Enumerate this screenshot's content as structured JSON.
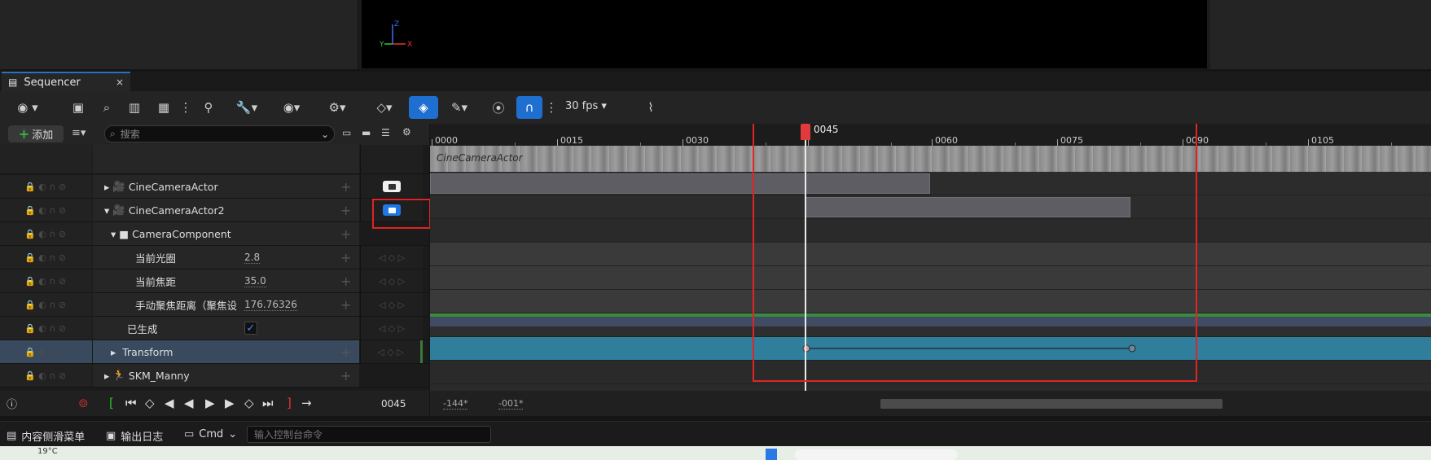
{
  "window": {
    "tab_title": "Sequencer",
    "close_glyph": "×"
  },
  "viewport": {
    "axis_z": "Z",
    "axis_y": "Y",
    "axis_x": "X"
  },
  "toolbar": {
    "fps_label": "30 fps",
    "icons": [
      "world-icon",
      "save-icon",
      "find-icon",
      "render-movie-icon",
      "clapper-icon",
      "more-icon",
      "actor-icon",
      "wrench-icon",
      "eye-icon",
      "gear-icon",
      "key-icon",
      "auto-key-icon",
      "pen-icon",
      "pin-icon",
      "snap-icon",
      "curve-editor-icon"
    ],
    "accent": "#1f6fd1"
  },
  "filterbar": {
    "add_label": "添加",
    "search_placeholder": "搜索"
  },
  "tree": {
    "rows": [
      {
        "label": "CineCameraActor",
        "indent": 1,
        "expanded": false
      },
      {
        "label": "CineCameraActor2",
        "indent": 1,
        "expanded": true
      },
      {
        "label": "CameraComponent",
        "indent": 2,
        "expanded": true
      },
      {
        "label": "当前光圈",
        "value": "2.8"
      },
      {
        "label": "当前焦距",
        "value": "35.0"
      },
      {
        "label": "手动聚焦距离（聚焦设",
        "value": "176.76326"
      },
      {
        "label": "已生成",
        "checked": true
      },
      {
        "label": "Transform",
        "selected": true
      },
      {
        "label": "SKM_Manny",
        "indent": 1
      }
    ]
  },
  "timeline": {
    "ruler_labels": [
      "0000",
      "0015",
      "0030",
      "0045",
      "0060",
      "0075",
      "0090",
      "0105"
    ],
    "playhead_label": "0045",
    "thumb_label": "CineCameraActor",
    "playhead_color": "#e23a3a"
  },
  "transport": {
    "current_frame": "0045",
    "range_start": "-144*",
    "range_end": "-001*"
  },
  "statusbar": {
    "content_drawer": "内容侧滑菜单",
    "output_log": "输出日志",
    "cmd": "Cmd",
    "cmd_placeholder": "输入控制台命令"
  },
  "taskbar": {
    "temperature": "19°C"
  }
}
